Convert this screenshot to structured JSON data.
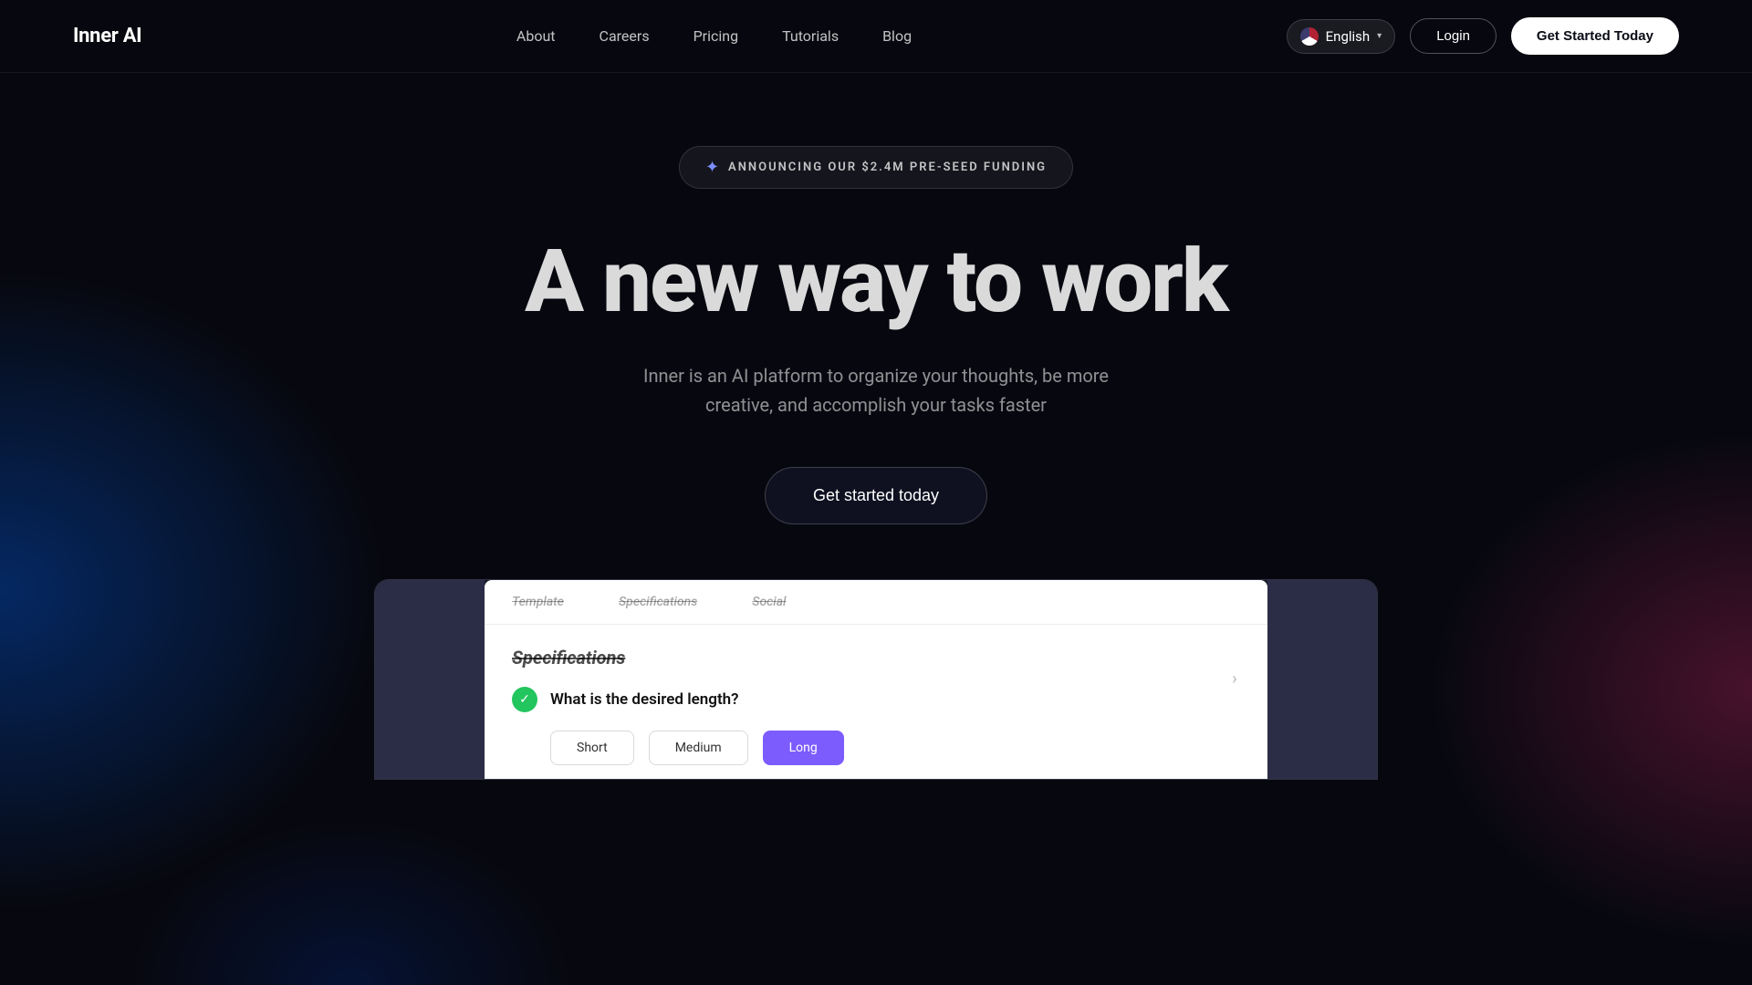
{
  "brand": {
    "name": "Inner AI"
  },
  "nav": {
    "links": [
      {
        "id": "about",
        "label": "About"
      },
      {
        "id": "careers",
        "label": "Careers"
      },
      {
        "id": "pricing",
        "label": "Pricing"
      },
      {
        "id": "tutorials",
        "label": "Tutorials"
      },
      {
        "id": "blog",
        "label": "Blog"
      }
    ],
    "language": "English",
    "login_label": "Login",
    "cta_label": "Get Started Today"
  },
  "hero": {
    "announcement": "ANNOUNCING OUR $2.4M PRE-SEED FUNDING",
    "title": "A new way to work",
    "subtitle": "Inner is an AI platform to organize your thoughts, be more creative, and accomplish your tasks faster",
    "cta_label": "Get started today"
  },
  "app_preview": {
    "tabs": [
      "Template",
      "Specifications",
      "Social"
    ],
    "section_title": "Specifications",
    "question": "What is the desired length?",
    "options": [
      "Short",
      "Medium",
      "Long"
    ]
  }
}
